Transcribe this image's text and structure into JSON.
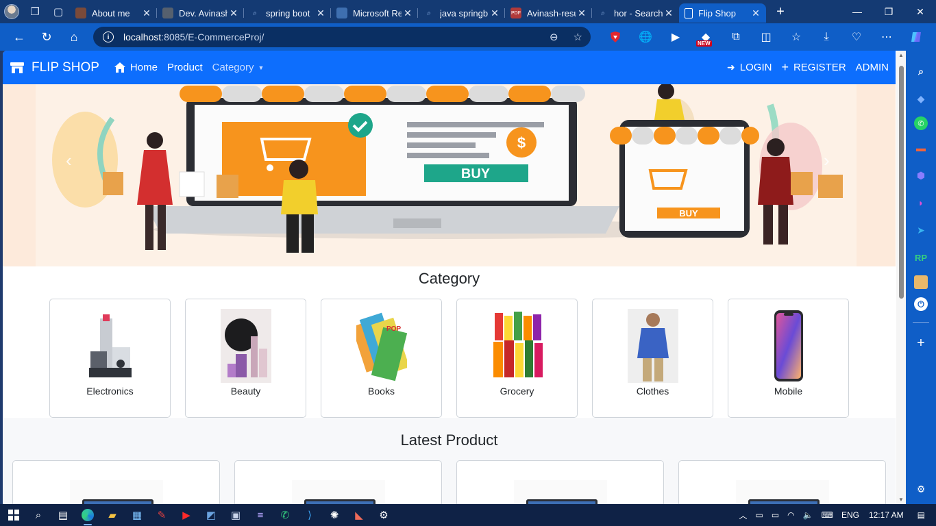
{
  "browser": {
    "tabs": [
      {
        "title": "About me",
        "favicon": "avatar-favicon",
        "active": false
      },
      {
        "title": "Dev. Avinash",
        "favicon": "avatar-favicon",
        "active": false
      },
      {
        "title": "spring boot",
        "favicon": "search-favicon",
        "active": false
      },
      {
        "title": "Microsoft Re",
        "favicon": "badge-favicon",
        "active": false
      },
      {
        "title": "java springb",
        "favicon": "search-favicon",
        "active": false
      },
      {
        "title": "Avinash-resu",
        "favicon": "pdf-favicon",
        "active": false
      },
      {
        "title": "hor - Search",
        "favicon": "search-favicon",
        "active": false
      },
      {
        "title": "Flip Shop",
        "favicon": "page-favicon",
        "active": true
      }
    ],
    "url_host": "localhost",
    "url_rest": ":8085/E-CommerceProj/",
    "new_badge": "NEW"
  },
  "sidebar": {
    "rp_label": "RP"
  },
  "site": {
    "brand": "FLIP SHOP",
    "nav": {
      "home": "Home",
      "product": "Product",
      "category": "Category",
      "login": "LOGIN",
      "register": "REGISTER",
      "admin": "ADMIN"
    },
    "hero": {
      "buy_main": "BUY",
      "buy_phone": "BUY"
    },
    "category_title": "Category",
    "categories": [
      {
        "label": "Electronics"
      },
      {
        "label": "Beauty"
      },
      {
        "label": "Books"
      },
      {
        "label": "Grocery"
      },
      {
        "label": "Clothes"
      },
      {
        "label": "Mobile"
      }
    ],
    "latest_title": "Latest Product"
  },
  "taskbar": {
    "language": "ENG",
    "time": "12:17 AM"
  },
  "colors": {
    "navbar": "#0d6efd",
    "browser_frame": "#0f5ec7",
    "tabbar": "#143a73",
    "taskbar": "#0f2246",
    "hero_bg": "#fdeadb",
    "awning_orange": "#f7941d"
  }
}
